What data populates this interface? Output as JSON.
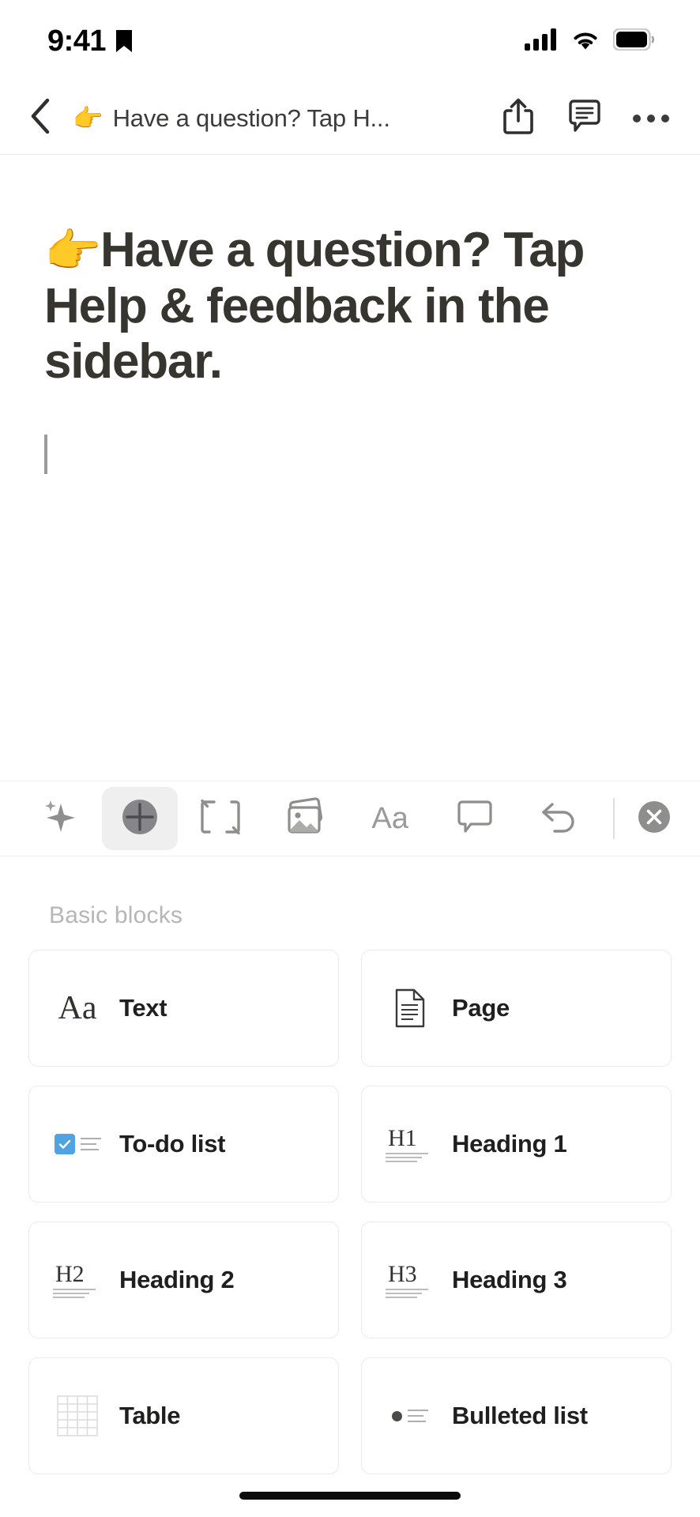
{
  "status_bar": {
    "time": "9:41",
    "bookmark_icon": "bookmark-icon",
    "cellular_icon": "cellular-bars-icon",
    "wifi_icon": "wifi-icon",
    "battery_icon": "battery-full-icon"
  },
  "nav_bar": {
    "back_icon": "chevron-left-icon",
    "title_emoji": "👉",
    "title": "Have a question? Tap H...",
    "share_icon": "share-icon",
    "comment_icon": "comment-icon",
    "more_icon": "ellipsis-icon"
  },
  "document": {
    "title_emoji": "👉",
    "title": "Have a question? Tap Help & feedback in the sidebar.",
    "caret_visible": true
  },
  "toolbar": {
    "items": [
      {
        "name": "ai-sparkle-icon",
        "label": "AI",
        "active": false
      },
      {
        "name": "add-block-icon",
        "label": "Add block",
        "active": true
      },
      {
        "name": "move-transfer-icon",
        "label": "Move",
        "active": false
      },
      {
        "name": "image-icon",
        "label": "Image",
        "active": false
      },
      {
        "name": "text-format-icon",
        "label": "Aa",
        "active": false
      },
      {
        "name": "comment-icon",
        "label": "Comment",
        "active": false
      },
      {
        "name": "undo-icon",
        "label": "Undo",
        "active": false
      }
    ],
    "aa_label": "Aa",
    "close_label": "close-icon"
  },
  "picker": {
    "section_label": "Basic blocks",
    "blocks": [
      {
        "label": "Text",
        "icon": "text-aa-icon"
      },
      {
        "label": "Page",
        "icon": "page-document-icon"
      },
      {
        "label": "To-do list",
        "icon": "todo-checkbox-icon"
      },
      {
        "label": "Heading 1",
        "icon": "heading-1-icon",
        "hx": "H1"
      },
      {
        "label": "Heading 2",
        "icon": "heading-2-icon",
        "hx": "H2"
      },
      {
        "label": "Heading 3",
        "icon": "heading-3-icon",
        "hx": "H3"
      },
      {
        "label": "Table",
        "icon": "table-grid-icon"
      },
      {
        "label": "Bulleted list",
        "icon": "bulleted-list-icon"
      }
    ]
  },
  "colors": {
    "accent_checkbox": "#4EA3E0",
    "text_primary": "#37352F",
    "text_muted": "#B6B6B4",
    "toolbar_icon": "#8E8E8C",
    "border": "#EAEAEA"
  },
  "home_indicator": "home-indicator"
}
